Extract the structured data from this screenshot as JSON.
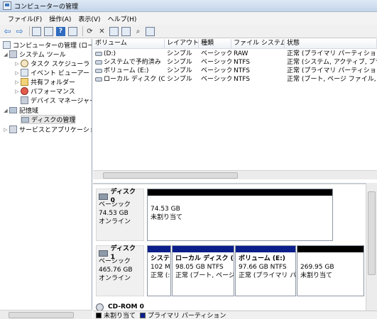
{
  "window": {
    "title": "コンピューターの管理"
  },
  "menu": [
    "ファイル(F)",
    "操作(A)",
    "表示(V)",
    "ヘルプ(H)"
  ],
  "toolbar": {
    "icons": [
      "back-arrow-icon",
      "forward-arrow-icon",
      "up-folder-icon",
      "show-hide-tree-icon",
      "help-icon",
      "properties-icon",
      "refresh-icon",
      "delete-icon",
      "new-window-icon",
      "export-icon",
      "search-icon",
      "settings-icon"
    ]
  },
  "tree": {
    "items": [
      {
        "label": "コンピューターの管理 (ローカ"
      },
      {
        "label": "システム ツール"
      },
      {
        "label": "タスク スケジューラ"
      },
      {
        "label": "イベント ビューアー"
      },
      {
        "label": "共有フォルダー"
      },
      {
        "label": "パフォーマンス"
      },
      {
        "label": "デバイス マネージャー"
      },
      {
        "label": "記憶域"
      },
      {
        "label": "ディスクの管理"
      },
      {
        "label": "サービスとアプリケーショ"
      }
    ]
  },
  "volume_list": {
    "columns": [
      "ボリューム",
      "レイアウト",
      "種類",
      "ファイル システム",
      "状態"
    ],
    "rows": [
      [
        "(D:)",
        "シンプル",
        "ベーシック",
        "RAW",
        "正常 (プライマリ パーティション"
      ],
      [
        "システムで予約済み",
        "シンプル",
        "ベーシック",
        "NTFS",
        "正常 (システム, アクティブ, プラ"
      ],
      [
        "ボリューム (E:)",
        "シンプル",
        "ベーシック",
        "NTFS",
        "正常 (プライマリ パーティション"
      ],
      [
        "ローカル ディスク (C:)",
        "シンプル",
        "ベーシック",
        "NTFS",
        "正常 (ブート, ページ ファイル, 69"
      ]
    ]
  },
  "disks": [
    {
      "name": "ディスク 0",
      "type": "ベーシック",
      "size": "74.53 GB",
      "status": "オンライン",
      "partitions": [
        {
          "title": "",
          "size": "74.53 GB",
          "status": "未割り当て",
          "color": "#000000"
        }
      ]
    },
    {
      "name": "ディスク 1",
      "type": "ベーシック",
      "size": "465.76 GB",
      "status": "オンライン",
      "partitions": [
        {
          "title": "システ",
          "size": "102 MI",
          "status": "正常 (:",
          "color": "#0b1f8b"
        },
        {
          "title": "ローカル ディスク (",
          "size": "98.05 GB NTFS",
          "status": "正常 (ブート, ページ",
          "color": "#0b1f8b"
        },
        {
          "title": "ボリューム (E:)",
          "size": "97.66 GB NTFS",
          "status": "正常 (プライマリ パー",
          "color": "#0b1f8b"
        },
        {
          "title": "",
          "size": "269.95 GB",
          "status": "未割り当て",
          "color": "#000000"
        }
      ]
    }
  ],
  "cdrom": {
    "name": "CD-ROM 0"
  },
  "legend": [
    {
      "label": "未割り当て",
      "color": "#000000"
    },
    {
      "label": "プライマリ パーティション",
      "color": "#0b1f8b"
    }
  ]
}
